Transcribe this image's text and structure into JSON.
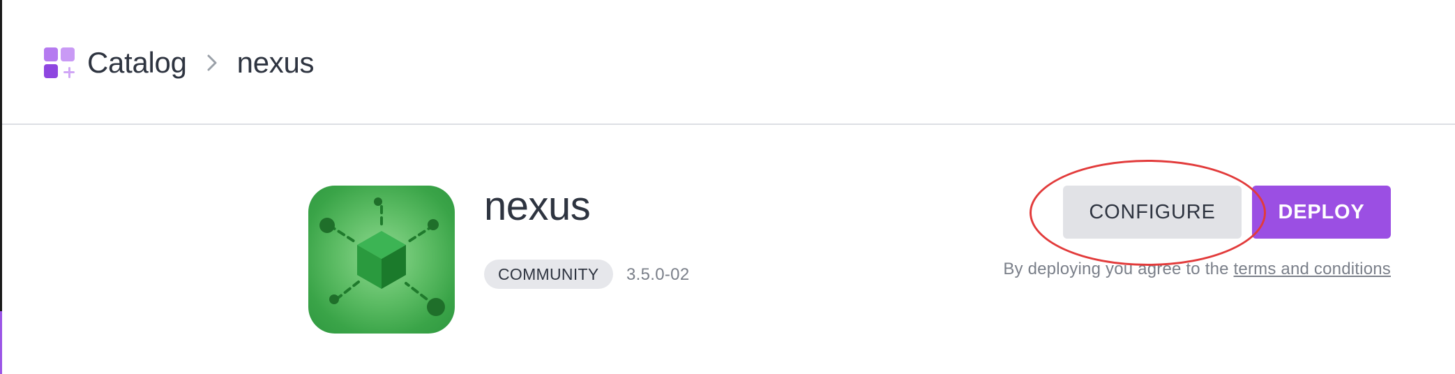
{
  "breadcrumb": {
    "root_label": "Catalog",
    "current_label": "nexus"
  },
  "app": {
    "title": "nexus",
    "badge": "COMMUNITY",
    "version": "3.5.0-02",
    "logo_icon": "nexus-cube-icon"
  },
  "actions": {
    "configure_label": "CONFIGURE",
    "deploy_label": "DEPLOY"
  },
  "agreement": {
    "prefix": "By deploying you agree to the",
    "link_text": "terms and conditions"
  },
  "colors": {
    "accent": "#9b4fe3",
    "highlight": "#e23b3b",
    "logo_green": "#3aa448"
  }
}
